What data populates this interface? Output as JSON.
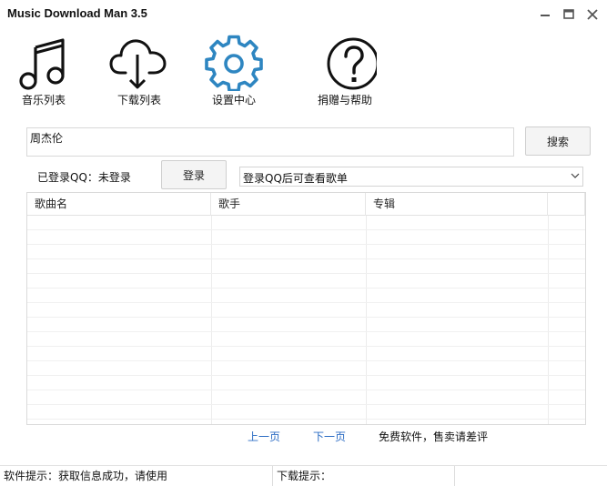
{
  "window": {
    "title": "Music Download Man 3.5"
  },
  "toolbar": {
    "items": [
      {
        "label": "音乐列表",
        "icon": "music-note-icon"
      },
      {
        "label": "下载列表",
        "icon": "cloud-download-icon"
      },
      {
        "label": "设置中心",
        "icon": "gear-icon"
      },
      {
        "label": "捐赠与帮助",
        "icon": "help-circle-icon"
      }
    ],
    "active_color": "#2e86c1"
  },
  "search": {
    "value": "周杰伦",
    "button_label": "搜索"
  },
  "login": {
    "status_text": "已登录QQ：未登录",
    "button_label": "登录",
    "playlist_select": "登录QQ后可查看歌单"
  },
  "table": {
    "columns": [
      "歌曲名",
      "歌手",
      "专辑",
      ""
    ],
    "rows": []
  },
  "pagination": {
    "prev_label": "上一页",
    "next_label": "下一页",
    "notice": "免费软件，售卖请差评"
  },
  "statusbar": {
    "info": "软件提示：获取信息成功，请使用",
    "download": "下载提示："
  }
}
